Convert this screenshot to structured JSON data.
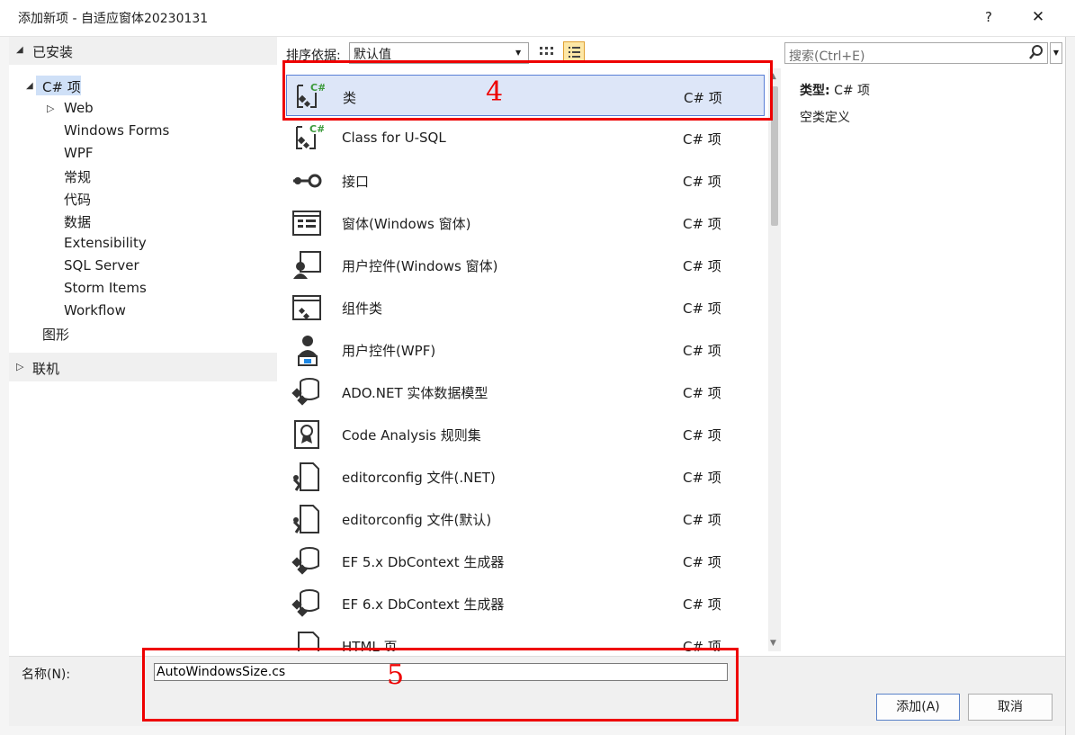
{
  "window": {
    "title": "添加新项 - 自适应窗体20230131",
    "help": "?",
    "close": "✕"
  },
  "tree": {
    "installed": "已安装",
    "csharp": "C# 项",
    "children": [
      "Web",
      "Windows Forms",
      "WPF",
      "常规",
      "代码",
      "数据",
      "Extensibility",
      "SQL Server",
      "Storm Items",
      "Workflow"
    ],
    "graphics": "图形",
    "online": "联机"
  },
  "sort": {
    "label": "排序依据:",
    "value": "默认值"
  },
  "search": {
    "placeholder": "搜索(Ctrl+E)"
  },
  "templates": [
    {
      "name": "类",
      "type": "C# 项",
      "icon": "class-icon",
      "selected": true
    },
    {
      "name": "Class for U-SQL",
      "type": "C# 项",
      "icon": "class-icon"
    },
    {
      "name": "接口",
      "type": "C# 项",
      "icon": "interface-icon"
    },
    {
      "name": "窗体(Windows 窗体)",
      "type": "C# 项",
      "icon": "form-icon"
    },
    {
      "name": "用户控件(Windows 窗体)",
      "type": "C# 项",
      "icon": "user-control-icon"
    },
    {
      "name": "组件类",
      "type": "C# 项",
      "icon": "component-icon"
    },
    {
      "name": "用户控件(WPF)",
      "type": "C# 项",
      "icon": "wpf-user-control-icon"
    },
    {
      "name": "ADO.NET 实体数据模型",
      "type": "C# 项",
      "icon": "data-model-icon"
    },
    {
      "name": "Code Analysis 规则集",
      "type": "C# 项",
      "icon": "ruleset-icon"
    },
    {
      "name": "editorconfig 文件(.NET)",
      "type": "C# 项",
      "icon": "config-file-icon"
    },
    {
      "name": "editorconfig 文件(默认)",
      "type": "C# 项",
      "icon": "config-file-icon"
    },
    {
      "name": "EF 5.x DbContext 生成器",
      "type": "C# 项",
      "icon": "data-model-icon"
    },
    {
      "name": "EF 6.x DbContext 生成器",
      "type": "C# 项",
      "icon": "data-model-icon"
    },
    {
      "name": "HTML 页",
      "type": "C# 项",
      "icon": "html-file-icon"
    }
  ],
  "details": {
    "type_label": "类型:",
    "type_value": "C# 项",
    "description": "空类定义"
  },
  "name_field": {
    "label": "名称(N):",
    "value": "AutoWindowsSize.cs"
  },
  "buttons": {
    "add": "添加(A)",
    "cancel": "取消"
  },
  "annotations": {
    "step4": "4",
    "step5": "5",
    "color": "#ee0000"
  },
  "colors": {
    "selection": "#dde6f8",
    "selection_border": "#5a7fd6",
    "tree_selection": "#cfe0f7"
  }
}
